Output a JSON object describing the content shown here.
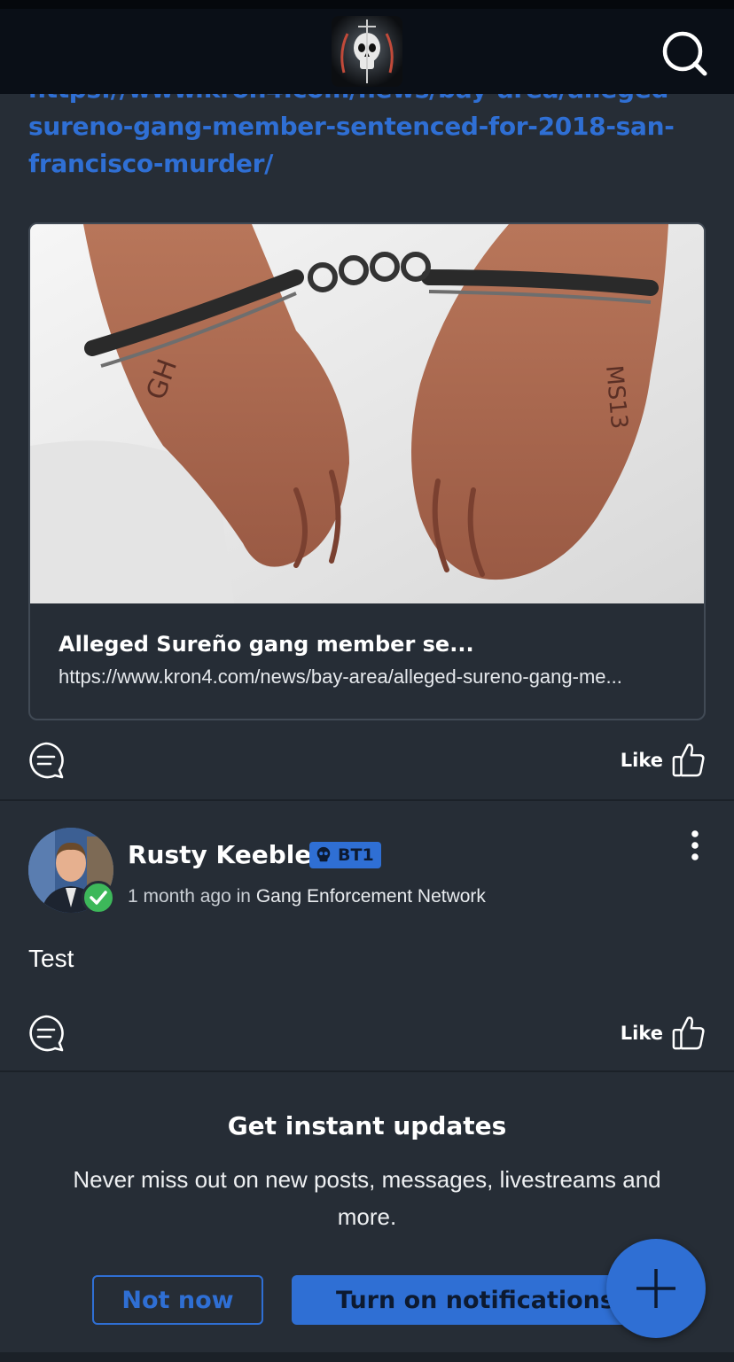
{
  "header": {
    "logo_alt": "Gang Enforcement Network logo",
    "search_icon": "search-icon"
  },
  "shared_post": {
    "link_text": "https://www.kron4.com/news/bay-area/alleged-sureno-gang-member-sentenced-for-2018-san-francisco-murder/",
    "preview": {
      "title": "Alleged Sureño gang member se...",
      "url": "https://www.kron4.com/news/bay-area/alleged-sureno-gang-me..."
    },
    "like_label": "Like"
  },
  "post": {
    "author": "Rusty Keeble",
    "badge": "BT1",
    "time": "1 month ago",
    "in_word": "in",
    "group": "Gang Enforcement Network",
    "body": "Test",
    "like_label": "Like"
  },
  "notifications": {
    "title": "Get instant updates",
    "text": "Never miss out on new posts, messages, livestreams and more.",
    "dismiss_label": "Not now",
    "enable_label": "Turn on notifications"
  },
  "colors": {
    "accent": "#2f6fd4",
    "background": "#262d36",
    "header": "#0a0f17",
    "verified": "#3db85a"
  }
}
